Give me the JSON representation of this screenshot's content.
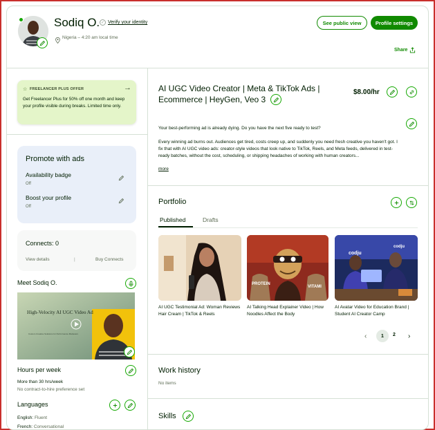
{
  "profile": {
    "name": "Sodiq O.",
    "verify_label": "Verify your identity",
    "location": "Nigeria – 4:20 am local time",
    "public_view_label": "See public view",
    "settings_label": "Profile settings",
    "share_label": "Share"
  },
  "promo": {
    "badge_label": "FREELANCER PLUS OFFER",
    "text": "Get Freelancer Plus for 50% off one month and keep your profile visible during breaks. Limited time only."
  },
  "promote_ads": {
    "title": "Promote with ads",
    "items": [
      {
        "label": "Availability badge",
        "status": "Off"
      },
      {
        "label": "Boost your profile",
        "status": "Off"
      }
    ]
  },
  "connects": {
    "title": "Connects: 0",
    "view_details": "View details",
    "separator": "|",
    "buy": "Buy Connects"
  },
  "video": {
    "title": "Meet Sodiq O.",
    "overlay_title": "High-Velocity AI UGC Video Ad",
    "overlay_sub": "Custom Creative Solutions for Performance Marketers"
  },
  "hours": {
    "title": "Hours per week",
    "value": "More than 30 hrs/week",
    "note": "No contract-to-hire preference set"
  },
  "languages": {
    "title": "Languages",
    "items": [
      {
        "name": "English:",
        "level": "Fluent"
      },
      {
        "name": "French:",
        "level": "Conversational"
      }
    ]
  },
  "headline": {
    "title": "AI UGC Video Creator | Meta & TikTok Ads | Ecommerce | HeyGen, Veo 3",
    "rate": "$8.00/hr",
    "intro": "Your best-performing ad is already dying. Do you have the next five ready to test?",
    "body": "Every winning ad burns out. Audiences get tired, costs creep up, and suddenly you need fresh creative you haven't got. I fix that with AI UGC video ads: creator-style videos that look native to TikTok, Reels, and Meta feeds, delivered in test-ready batches, without the cost, scheduling, or shipping headaches of working with human creators...",
    "more": "more"
  },
  "portfolio": {
    "title": "Portfolio",
    "tabs": [
      "Published",
      "Drafts"
    ],
    "items": [
      {
        "caption": "AI UGC Testimonial Ad: Woman Reviews Hair Cream | TikTok & Reels"
      },
      {
        "caption": "AI Talking Head Explainer Video | How Noodles Affect the Body",
        "tag_left": "PROTEIN",
        "tag_right": "VITAMI"
      },
      {
        "caption": "AI Avatar Video for Education Brand | Student AI Creator Camp",
        "brand_a": "codju",
        "brand_b": "codju"
      }
    ],
    "pages": [
      "1",
      "2"
    ],
    "prev": "‹",
    "next": "›"
  },
  "work_history": {
    "title": "Work history",
    "empty": "No items"
  },
  "skills": {
    "title": "Skills"
  },
  "colors": {
    "brand": "#108a00",
    "accent": "#14a800",
    "promo_bg": "#e4f5c9",
    "ads_bg": "#e9eff9"
  },
  "icons": {
    "edit": "pencil-icon",
    "add": "plus-icon",
    "share": "share-icon",
    "location": "pin-icon",
    "link": "link-icon",
    "star": "star-icon",
    "arrow": "arrow-right-icon",
    "reorder": "reorder-icon",
    "verify": "check-badge-icon",
    "play": "play-icon"
  }
}
